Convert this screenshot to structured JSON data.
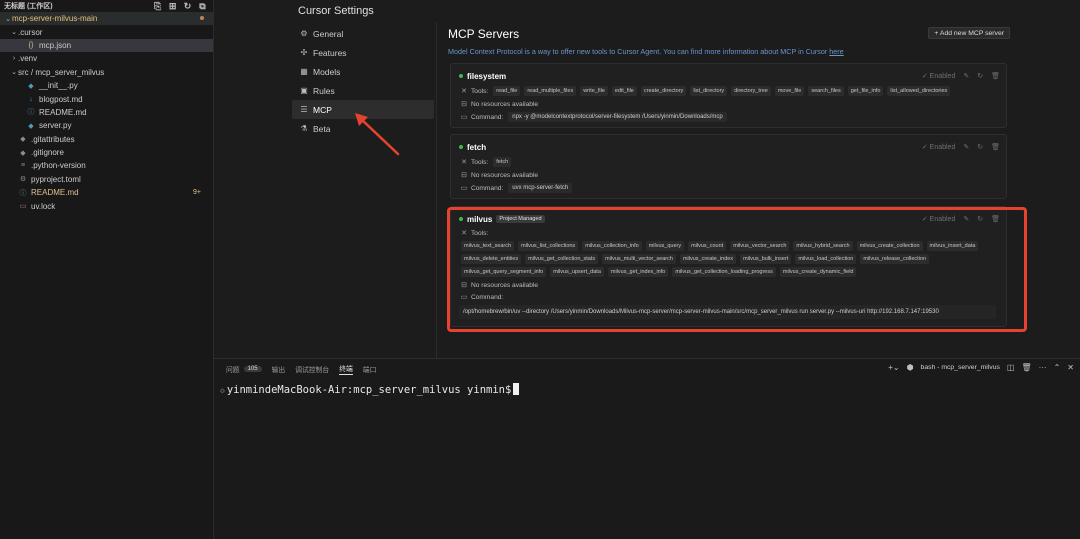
{
  "explorer": {
    "header": "无标题 (工作区)",
    "items": [
      {
        "label": "mcp-server-milvus-main",
        "chev": "⌄",
        "icon": "",
        "indent": 4,
        "kind": "root"
      },
      {
        "label": ".cursor",
        "chev": "⌄",
        "icon": "",
        "indent": 10,
        "kind": "folder"
      },
      {
        "label": "mcp.json",
        "chev": "",
        "icon": "{}",
        "indent": 18,
        "kind": "selected"
      },
      {
        "label": ".venv",
        "chev": "›",
        "icon": "",
        "indent": 10,
        "kind": "folder"
      },
      {
        "label": "src / mcp_server_milvus",
        "chev": "⌄",
        "icon": "",
        "indent": 10,
        "kind": "folder"
      },
      {
        "label": "__init__.py",
        "chev": "",
        "icon": "◆",
        "indent": 18,
        "kind": "py"
      },
      {
        "label": "blogpost.md",
        "chev": "",
        "icon": "↓",
        "indent": 18,
        "kind": "md"
      },
      {
        "label": "README.md",
        "chev": "",
        "icon": "ⓘ",
        "indent": 18,
        "kind": "md"
      },
      {
        "label": "server.py",
        "chev": "",
        "icon": "◆",
        "indent": 18,
        "kind": "py"
      },
      {
        "label": ".gitattributes",
        "chev": "",
        "icon": "◆",
        "indent": 10,
        "kind": "git"
      },
      {
        "label": ".gitignore",
        "chev": "",
        "icon": "◆",
        "indent": 10,
        "kind": "git"
      },
      {
        "label": ".python-version",
        "chev": "",
        "icon": "≡",
        "indent": 10,
        "kind": "plain"
      },
      {
        "label": "pyproject.toml",
        "chev": "",
        "icon": "⚙",
        "indent": 10,
        "kind": "plain"
      },
      {
        "label": "README.md",
        "chev": "",
        "icon": "ⓘ",
        "indent": 10,
        "kind": "readme",
        "badge": "9+"
      },
      {
        "label": "uv.lock",
        "chev": "",
        "icon": "▭",
        "indent": 10,
        "kind": "plain"
      }
    ]
  },
  "settings": {
    "title": "Cursor Settings",
    "nav": [
      {
        "label": "General",
        "icon": "⚙"
      },
      {
        "label": "Features",
        "icon": "✣"
      },
      {
        "label": "Models",
        "icon": "▦"
      },
      {
        "label": "Rules",
        "icon": "▣"
      },
      {
        "label": "MCP",
        "icon": "☰"
      },
      {
        "label": "Beta",
        "icon": "⚗"
      }
    ]
  },
  "mcp": {
    "title": "MCP Servers",
    "add_button": "+ Add new MCP server",
    "desc": "Model Context Protocol is a way to offer new tools to Cursor Agent. You can find more information about MCP in Cursor",
    "desc_link": "here",
    "enabled_label": "Enabled",
    "tools_label": "Tools:",
    "no_resources": "No resources available",
    "command_label": "Command:",
    "project_badge": "Project Managed",
    "servers": {
      "filesystem": {
        "name": "filesystem",
        "tools": [
          "read_file",
          "read_multiple_files",
          "write_file",
          "edit_file",
          "create_directory",
          "list_directory",
          "directory_tree",
          "move_file",
          "search_files",
          "get_file_info",
          "list_allowed_directories"
        ],
        "command": "npx -y @modelcontextprotocol/server-filesystem /Users/yinmin/Downloads/mcp"
      },
      "fetch": {
        "name": "fetch",
        "tools": [
          "fetch"
        ],
        "command": "uvx mcp-server-fetch"
      },
      "milvus": {
        "name": "milvus",
        "tools": [
          "milvus_text_search",
          "milvus_list_collections",
          "milvus_collection_info",
          "milvus_query",
          "milvus_count",
          "milvus_vector_search",
          "milvus_hybrid_search",
          "milvus_create_collection",
          "milvus_insert_data",
          "milvus_delete_entities",
          "milvus_get_collection_stats",
          "milvus_multi_vector_search",
          "milvus_create_index",
          "milvus_bulk_insert",
          "milvus_load_collection",
          "milvus_release_collection",
          "milvus_get_query_segment_info",
          "milvus_upsert_data",
          "milvus_get_index_info",
          "milvus_get_collection_loading_progress",
          "milvus_create_dynamic_field"
        ],
        "command": "/opt/homebrew/bin/uv --directory /Users/yinmin/Downloads/Milvus-mcp-server/mcp-server-milvus-main/src/mcp_server_milvus run server.py --milvus-uri http://192.168.7.147:19530"
      }
    }
  },
  "panel": {
    "tabs": [
      {
        "label": "问题",
        "count": "105"
      },
      {
        "label": "输出"
      },
      {
        "label": "调试控制台"
      },
      {
        "label": "终端",
        "active": true
      },
      {
        "label": "端口"
      }
    ],
    "terminal_name": "bash - mcp_server_milvus",
    "prompt": "yinmindeMacBook-Air:mcp_server_milvus yinmin$"
  },
  "colors": {
    "accent_red": "#e5432f",
    "status_green": "#3fb950",
    "link_blue": "#6a95c9"
  }
}
